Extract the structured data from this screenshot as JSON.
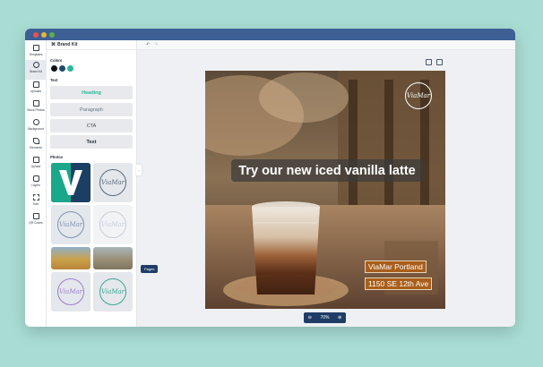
{
  "rail": [
    {
      "name": "rail-templates",
      "label": "Templates"
    },
    {
      "name": "rail-brand-kit",
      "label": "Brand Kit",
      "active": true
    },
    {
      "name": "rail-uploads",
      "label": "Uploads"
    },
    {
      "name": "rail-stock-photos",
      "label": "Stock Photos"
    },
    {
      "name": "rail-background",
      "label": "Background"
    },
    {
      "name": "rail-elements",
      "label": "Elements"
    },
    {
      "name": "rail-upload",
      "label": "Upload"
    },
    {
      "name": "rail-layers",
      "label": "Layers"
    },
    {
      "name": "rail-size",
      "label": "Size"
    },
    {
      "name": "rail-qr-codes",
      "label": "QR Codes"
    }
  ],
  "panel": {
    "title": "Brand Kit",
    "colors_label": "Colors",
    "colors": [
      "#111418",
      "#1e4a6b",
      "#2bb69a"
    ],
    "text_label": "Text",
    "text_styles": {
      "heading": "Heading",
      "paragraph": "Paragraph",
      "cta": "CTA",
      "text": "Text"
    },
    "photos_label": "Photos",
    "logo_text": "ViaMar"
  },
  "pages_button": "Pages",
  "design": {
    "headline": "Try our new iced vanilla latte",
    "location_name": "ViaMar Portland",
    "address": "1150 SE 12th Ave",
    "logo_text": "ViaMar"
  },
  "zoom": {
    "minus": "⊖",
    "level": "70%",
    "plus": "⊕"
  }
}
